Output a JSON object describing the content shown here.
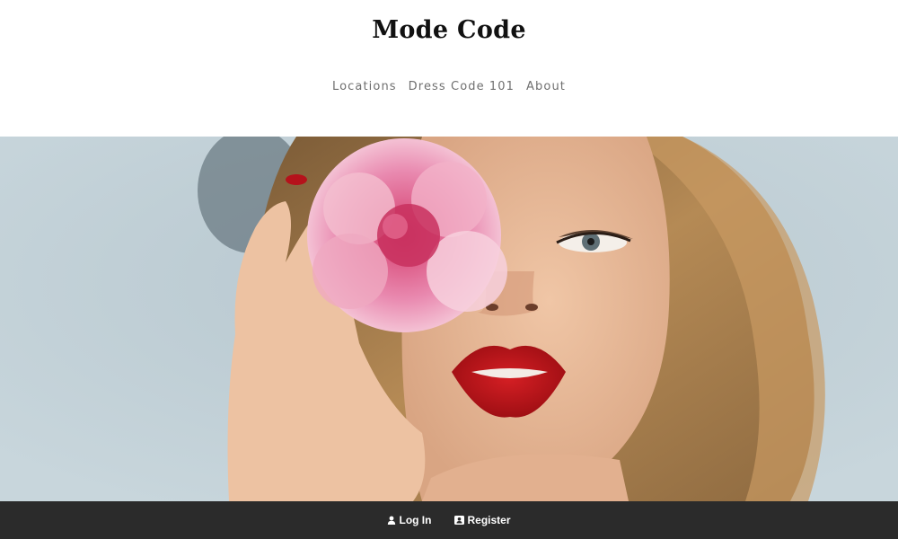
{
  "site": {
    "title": "Mode Code"
  },
  "nav": {
    "items": [
      {
        "label": "Locations"
      },
      {
        "label": "Dress Code 101"
      },
      {
        "label": "About"
      }
    ]
  },
  "hero": {
    "icon": "hero-photo"
  },
  "footer": {
    "login_label": "Log In",
    "login_icon": "user-icon",
    "register_label": "Register",
    "register_icon": "user-card-icon"
  },
  "colors": {
    "header_bg": "#ffffff",
    "footer_bg": "#2b2b2b",
    "nav_text": "#6f6f6f",
    "title_text": "#111111"
  }
}
